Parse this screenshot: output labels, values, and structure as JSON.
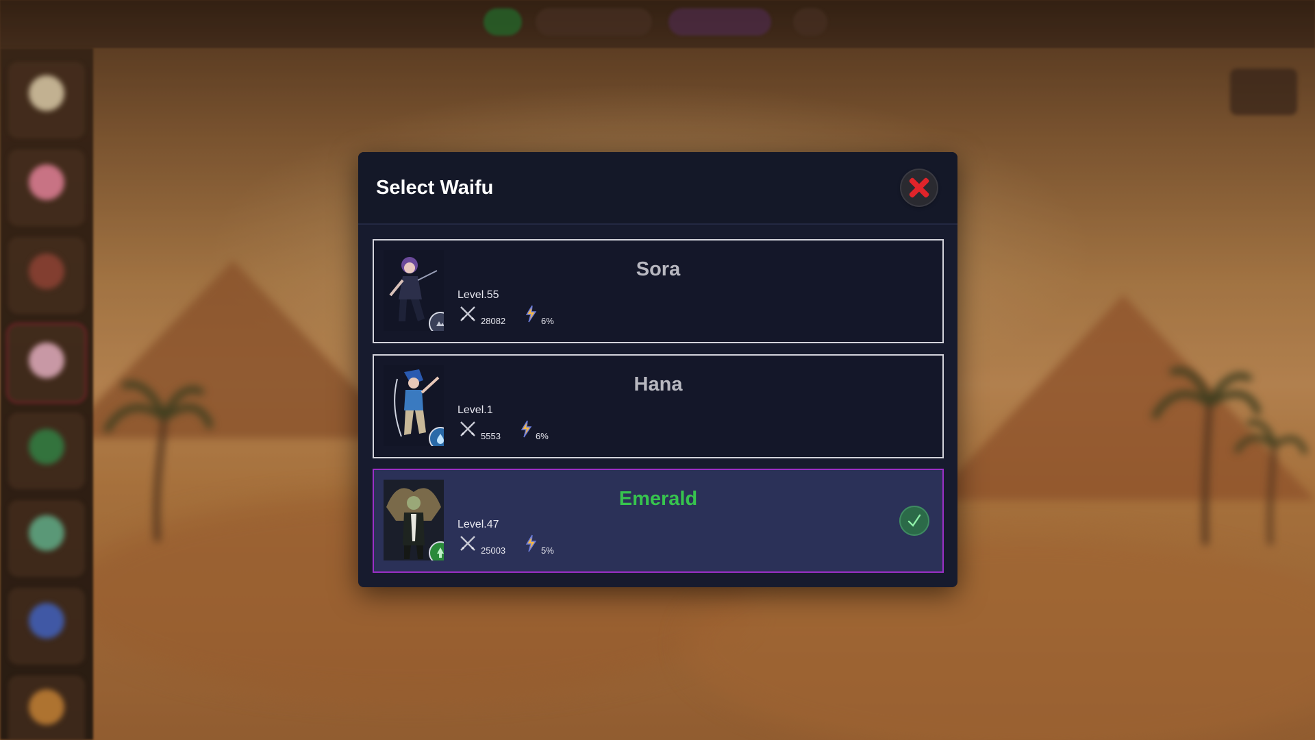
{
  "modal": {
    "title": "Select Waifu",
    "close_icon": "close-x-icon"
  },
  "waifus": [
    {
      "name": "Sora",
      "level": "Level.55",
      "power": "28082",
      "crit": "6%",
      "element_icon": "earth-element-icon",
      "selected": false
    },
    {
      "name": "Hana",
      "level": "Level.1",
      "power": "5553",
      "crit": "6%",
      "element_icon": "water-element-icon",
      "selected": false
    },
    {
      "name": "Emerald",
      "level": "Level.47",
      "power": "25003",
      "crit": "5%",
      "element_icon": "nature-element-icon",
      "selected": true
    }
  ],
  "colors": {
    "selected_name": "#37c44e",
    "selected_border": "#9b2fc7",
    "close_icon": "#e0242a"
  }
}
